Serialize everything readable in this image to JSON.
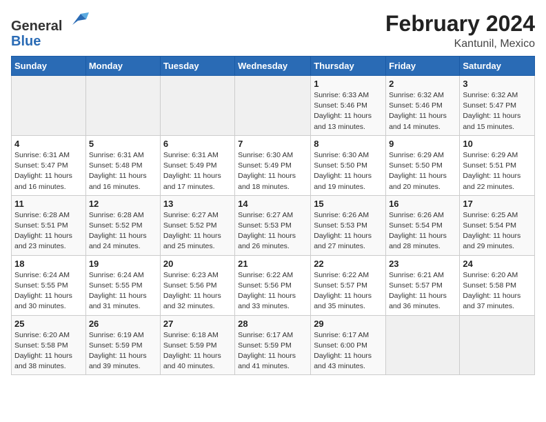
{
  "header": {
    "logo_general": "General",
    "logo_blue": "Blue",
    "main_title": "February 2024",
    "subtitle": "Kantunil, Mexico"
  },
  "calendar": {
    "days_of_week": [
      "Sunday",
      "Monday",
      "Tuesday",
      "Wednesday",
      "Thursday",
      "Friday",
      "Saturday"
    ],
    "weeks": [
      [
        {
          "day": "",
          "info": ""
        },
        {
          "day": "",
          "info": ""
        },
        {
          "day": "",
          "info": ""
        },
        {
          "day": "",
          "info": ""
        },
        {
          "day": "1",
          "info": "Sunrise: 6:33 AM\nSunset: 5:46 PM\nDaylight: 11 hours and 13 minutes."
        },
        {
          "day": "2",
          "info": "Sunrise: 6:32 AM\nSunset: 5:46 PM\nDaylight: 11 hours and 14 minutes."
        },
        {
          "day": "3",
          "info": "Sunrise: 6:32 AM\nSunset: 5:47 PM\nDaylight: 11 hours and 15 minutes."
        }
      ],
      [
        {
          "day": "4",
          "info": "Sunrise: 6:31 AM\nSunset: 5:47 PM\nDaylight: 11 hours and 16 minutes."
        },
        {
          "day": "5",
          "info": "Sunrise: 6:31 AM\nSunset: 5:48 PM\nDaylight: 11 hours and 16 minutes."
        },
        {
          "day": "6",
          "info": "Sunrise: 6:31 AM\nSunset: 5:49 PM\nDaylight: 11 hours and 17 minutes."
        },
        {
          "day": "7",
          "info": "Sunrise: 6:30 AM\nSunset: 5:49 PM\nDaylight: 11 hours and 18 minutes."
        },
        {
          "day": "8",
          "info": "Sunrise: 6:30 AM\nSunset: 5:50 PM\nDaylight: 11 hours and 19 minutes."
        },
        {
          "day": "9",
          "info": "Sunrise: 6:29 AM\nSunset: 5:50 PM\nDaylight: 11 hours and 20 minutes."
        },
        {
          "day": "10",
          "info": "Sunrise: 6:29 AM\nSunset: 5:51 PM\nDaylight: 11 hours and 22 minutes."
        }
      ],
      [
        {
          "day": "11",
          "info": "Sunrise: 6:28 AM\nSunset: 5:51 PM\nDaylight: 11 hours and 23 minutes."
        },
        {
          "day": "12",
          "info": "Sunrise: 6:28 AM\nSunset: 5:52 PM\nDaylight: 11 hours and 24 minutes."
        },
        {
          "day": "13",
          "info": "Sunrise: 6:27 AM\nSunset: 5:52 PM\nDaylight: 11 hours and 25 minutes."
        },
        {
          "day": "14",
          "info": "Sunrise: 6:27 AM\nSunset: 5:53 PM\nDaylight: 11 hours and 26 minutes."
        },
        {
          "day": "15",
          "info": "Sunrise: 6:26 AM\nSunset: 5:53 PM\nDaylight: 11 hours and 27 minutes."
        },
        {
          "day": "16",
          "info": "Sunrise: 6:26 AM\nSunset: 5:54 PM\nDaylight: 11 hours and 28 minutes."
        },
        {
          "day": "17",
          "info": "Sunrise: 6:25 AM\nSunset: 5:54 PM\nDaylight: 11 hours and 29 minutes."
        }
      ],
      [
        {
          "day": "18",
          "info": "Sunrise: 6:24 AM\nSunset: 5:55 PM\nDaylight: 11 hours and 30 minutes."
        },
        {
          "day": "19",
          "info": "Sunrise: 6:24 AM\nSunset: 5:55 PM\nDaylight: 11 hours and 31 minutes."
        },
        {
          "day": "20",
          "info": "Sunrise: 6:23 AM\nSunset: 5:56 PM\nDaylight: 11 hours and 32 minutes."
        },
        {
          "day": "21",
          "info": "Sunrise: 6:22 AM\nSunset: 5:56 PM\nDaylight: 11 hours and 33 minutes."
        },
        {
          "day": "22",
          "info": "Sunrise: 6:22 AM\nSunset: 5:57 PM\nDaylight: 11 hours and 35 minutes."
        },
        {
          "day": "23",
          "info": "Sunrise: 6:21 AM\nSunset: 5:57 PM\nDaylight: 11 hours and 36 minutes."
        },
        {
          "day": "24",
          "info": "Sunrise: 6:20 AM\nSunset: 5:58 PM\nDaylight: 11 hours and 37 minutes."
        }
      ],
      [
        {
          "day": "25",
          "info": "Sunrise: 6:20 AM\nSunset: 5:58 PM\nDaylight: 11 hours and 38 minutes."
        },
        {
          "day": "26",
          "info": "Sunrise: 6:19 AM\nSunset: 5:59 PM\nDaylight: 11 hours and 39 minutes."
        },
        {
          "day": "27",
          "info": "Sunrise: 6:18 AM\nSunset: 5:59 PM\nDaylight: 11 hours and 40 minutes."
        },
        {
          "day": "28",
          "info": "Sunrise: 6:17 AM\nSunset: 5:59 PM\nDaylight: 11 hours and 41 minutes."
        },
        {
          "day": "29",
          "info": "Sunrise: 6:17 AM\nSunset: 6:00 PM\nDaylight: 11 hours and 43 minutes."
        },
        {
          "day": "",
          "info": ""
        },
        {
          "day": "",
          "info": ""
        }
      ]
    ]
  }
}
